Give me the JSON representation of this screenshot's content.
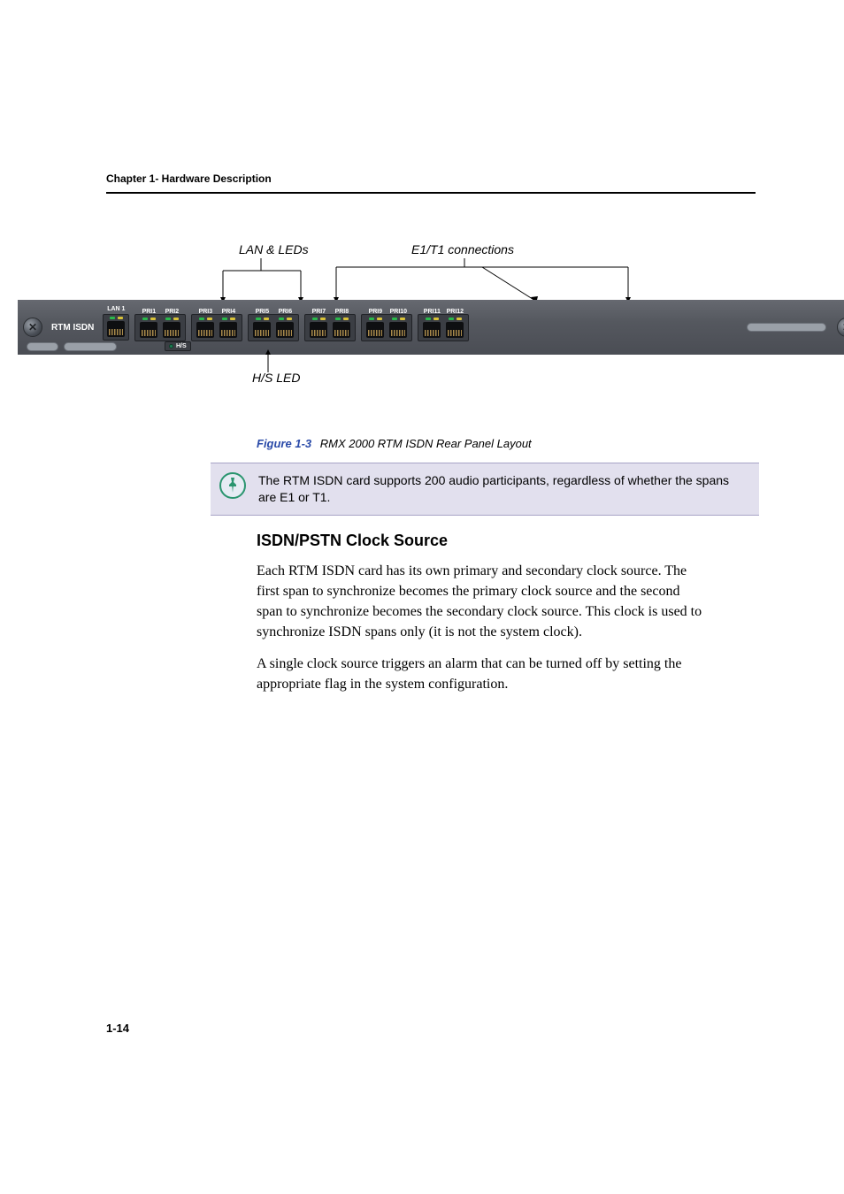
{
  "chapter_header": "Chapter 1- Hardware Description",
  "diagram": {
    "lan_leds_label": "LAN & LEDs",
    "e1t1_label": "E1/T1 connections",
    "hs_led_label": "H/S LED",
    "panel_title": "RTM ISDN",
    "lan_port": "LAN 1",
    "hs_text": "H/S",
    "pri_ports": [
      "PRI1",
      "PRI2",
      "PRI3",
      "PRI4",
      "PRI5",
      "PRI6",
      "PRI7",
      "PRI8",
      "PRI9",
      "PRI10",
      "PRI11",
      "PRI12"
    ]
  },
  "caption": {
    "figure": "Figure 1-3",
    "text": "RMX 2000 RTM ISDN Rear Panel Layout"
  },
  "note": "The RTM ISDN card supports 200 audio participants, regardless of whether the spans are E1 or T1.",
  "section_heading": "ISDN/PSTN Clock Source",
  "para1": "Each RTM ISDN card has its own primary and secondary clock source. The first span to synchronize becomes the primary clock source and the second span to synchronize becomes the secondary clock source. This clock is used to synchronize ISDN spans only (it is not the system clock).",
  "para2": "A single clock source triggers an alarm that can be turned off by setting the appropriate flag in the system configuration.",
  "page_number": "1-14"
}
